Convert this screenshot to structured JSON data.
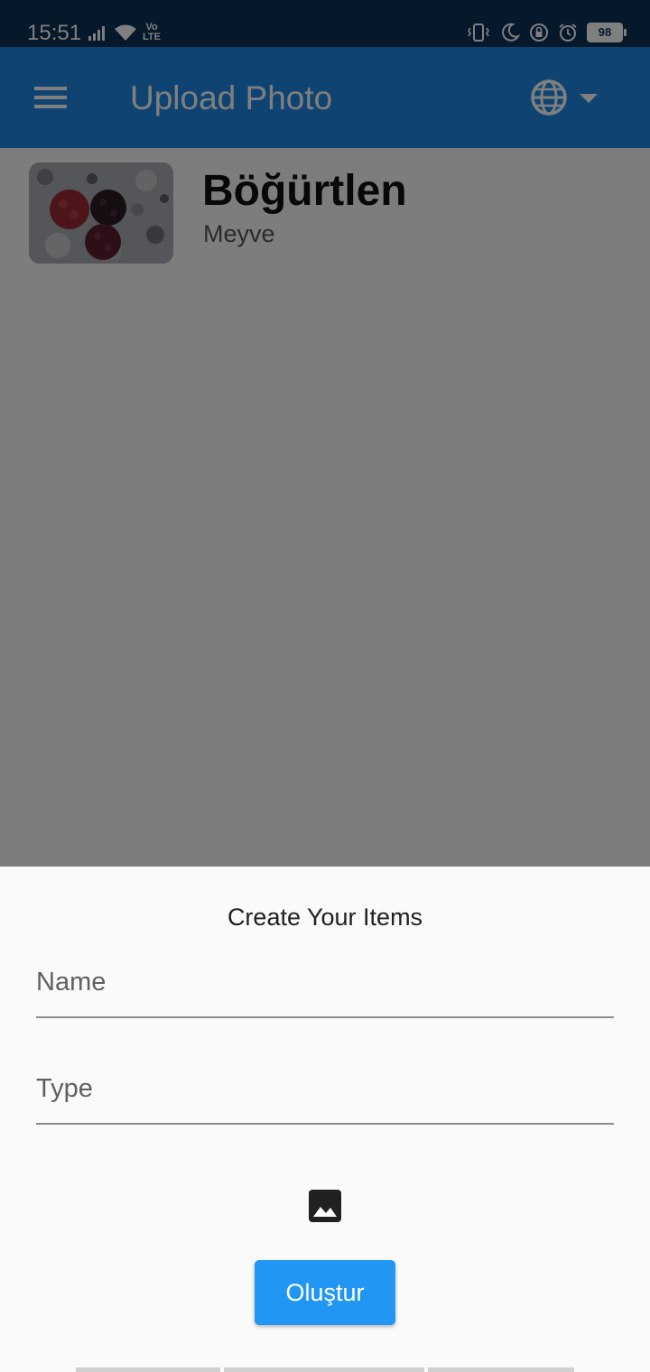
{
  "status_bar": {
    "time": "15:51",
    "volte_line1": "Vo",
    "volte_line2": "LTE",
    "battery": "98",
    "icons": [
      "signal-icon",
      "wifi-icon",
      "volte-icon",
      "vibrate-icon",
      "moon-icon",
      "rotation-lock-icon",
      "alarm-icon",
      "battery-icon"
    ]
  },
  "app_bar": {
    "title": "Upload Photo",
    "menu_icon": "menu-icon",
    "language_icon": "globe-icon",
    "dropdown_icon": "arrow-drop-down-icon",
    "color": "#1e88e5"
  },
  "items": [
    {
      "title": "Böğürtlen",
      "subtitle": "Meyve",
      "image": "blackberry-photo"
    }
  ],
  "sheet": {
    "title": "Create Your Items",
    "name_placeholder": "Name",
    "name_value": "",
    "type_placeholder": "Type",
    "type_value": "",
    "image_icon": "image-icon",
    "create_button": "Oluştur",
    "button_color": "#2196f3"
  }
}
